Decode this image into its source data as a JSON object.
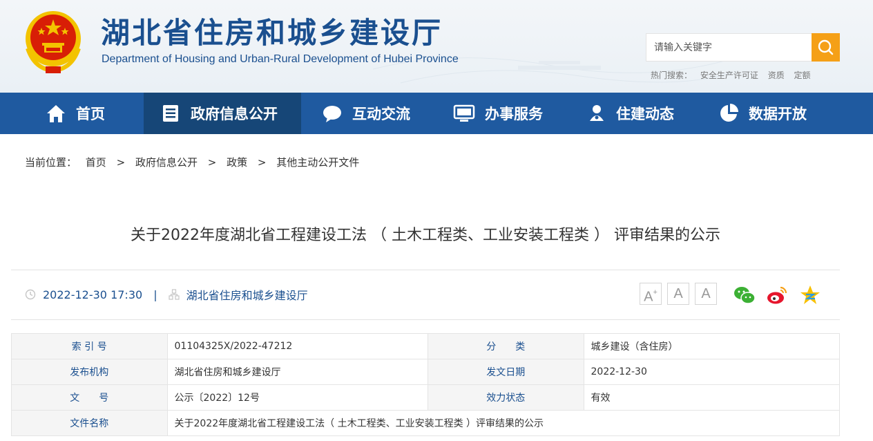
{
  "header": {
    "title": "湖北省住房和城乡建设厅",
    "subtitle": "Department of Housing and Urban-Rural Development of Hubei Province",
    "emblem": "national-emblem"
  },
  "search": {
    "placeholder": "请输入关键字",
    "icon": "search-icon",
    "hot_label": "热门搜索：",
    "hot_terms": [
      "安全生产许可证",
      "资质",
      "定额"
    ]
  },
  "nav": {
    "items": [
      {
        "label": "首页",
        "icon": "home-icon"
      },
      {
        "label": "政府信息公开",
        "icon": "document-list-icon",
        "active": true
      },
      {
        "label": "互动交流",
        "icon": "chat-bubble-icon"
      },
      {
        "label": "办事服务",
        "icon": "monitor-icon"
      },
      {
        "label": "住建动态",
        "icon": "person-icon"
      },
      {
        "label": "数据开放",
        "icon": "pie-chart-icon"
      }
    ]
  },
  "breadcrumb": {
    "label": "当前位置：",
    "separator": ">",
    "items": [
      "首页",
      "政府信息公开",
      "政策",
      "其他主动公开文件"
    ]
  },
  "article": {
    "title": "关于2022年度湖北省工程建设工法 （ 土木工程类、工业安装工程类 ） 评审结果的公示",
    "datetime": "2022-12-30 17:30",
    "divider": "|",
    "source": "湖北省住房和城乡建设厅",
    "font_sizes": [
      "A",
      "A",
      "A"
    ],
    "font_plus": "+",
    "share_icons": [
      "wechat-icon",
      "weibo-icon",
      "qzone-icon"
    ]
  },
  "info_table": {
    "rows": [
      {
        "k1": "索 引 号",
        "v1": "01104325X/2022-47212",
        "k2": "分　　类",
        "v2": "城乡建设（含住房）"
      },
      {
        "k1": "发布机构",
        "v1": "湖北省住房和城乡建设厅",
        "k2": "发文日期",
        "v2": "2022-12-30"
      },
      {
        "k1": "文　　号",
        "v1": "公示〔2022〕12号",
        "k2": "效力状态",
        "v2": "有效"
      },
      {
        "k1": "文件名称",
        "v1": "关于2022年度湖北省工程建设工法（ 土木工程类、工业安装工程类 ）评审结果的公示"
      }
    ]
  },
  "colors": {
    "nav_bg": "#1f5aa0",
    "nav_active": "#164677",
    "brand_blue": "#1a4f8f",
    "search_btn": "#f5a017",
    "emblem_red": "#d81e06",
    "emblem_gold": "#f3c300"
  }
}
